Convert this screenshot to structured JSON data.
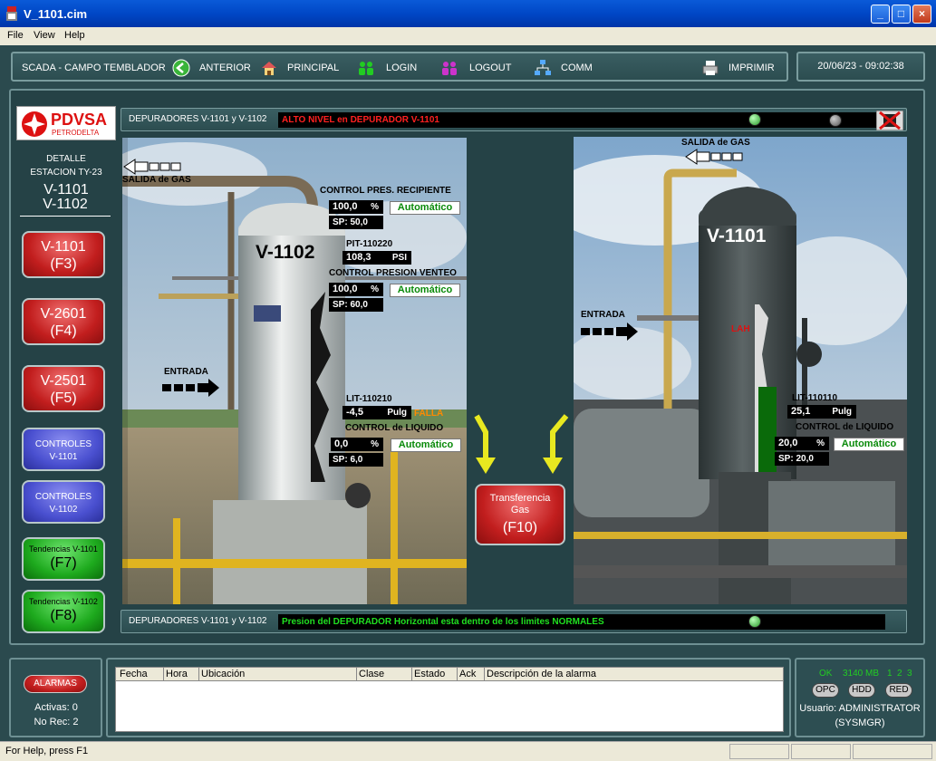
{
  "window": {
    "title": "V_1101.cim"
  },
  "menu": [
    "File",
    "View",
    "Help"
  ],
  "toolbar": {
    "app_label": "SCADA - CAMPO TEMBLADOR",
    "anterior": "ANTERIOR",
    "principal": "PRINCIPAL",
    "login": "LOGIN",
    "logout": "LOGOUT",
    "comm": "COMM",
    "imprimir": "IMPRIMIR",
    "datetime": "20/06/23 - 09:02:38"
  },
  "sidebar": {
    "logo_text": "PDVSA",
    "logo_sub": "PETRODELTA",
    "detail_line1": "DETALLE",
    "detail_line2": "ESTACION TY-23",
    "vessel1": "V-1101",
    "vessel2": "V-1102",
    "buttons": [
      {
        "line1": "V-1101",
        "line2": "(F3)"
      },
      {
        "line1": "V-2601",
        "line2": "(F4)"
      },
      {
        "line1": "V-2501",
        "line2": "(F5)"
      },
      {
        "line1": "CONTROLES",
        "line2": "V-1101"
      },
      {
        "line1": "CONTROLES",
        "line2": "V-1102"
      },
      {
        "line1": "Tendencias V-1101",
        "line2": "(F7)"
      },
      {
        "line1": "Tendencias V-1102",
        "line2": "(F8)"
      }
    ]
  },
  "top_message": {
    "label": "DEPURADORES V-1101 y V-1102",
    "text": "ALTO NIVEL en DEPURADOR V-1101",
    "color": "#ff2020"
  },
  "bottom_message": {
    "label": "DEPURADORES V-1101 y V-1102",
    "text": "Presion del DEPURADOR Horizontal esta dentro de los limites NORMALES",
    "color": "#20e020"
  },
  "v1102": {
    "name": "V-1102",
    "salida_gas": "SALIDA de GAS",
    "entrada": "ENTRADA",
    "ctrl_pres_title": "CONTROL PRES. RECIPIENTE",
    "ctrl_pres_value": "100,0",
    "ctrl_pres_unit": "%",
    "ctrl_pres_mode": "Automático",
    "ctrl_pres_sp": "SP: 50,0",
    "pit_tag": "PIT-110220",
    "pit_value": "108,3",
    "pit_unit": "PSI",
    "venteo_title": "CONTROL PRESION VENTEO",
    "venteo_value": "100,0",
    "venteo_unit": "%",
    "venteo_mode": "Automático",
    "venteo_sp": "SP: 60,0",
    "lit_tag": "LIT-110210",
    "lit_value": "-4,5",
    "lit_unit": "Pulg",
    "lit_status": "FALLA",
    "liq_title": "CONTROL de LIQUIDO",
    "liq_value": "0,0",
    "liq_unit": "%",
    "liq_mode": "Automático",
    "liq_sp": "SP: 6,0"
  },
  "v1101": {
    "name": "V-1101",
    "salida_gas": "SALIDA de GAS",
    "entrada": "ENTRADA",
    "lah": "LAH",
    "lit_tag": "LIT-110110",
    "lit_value": "25,1",
    "lit_unit": "Pulg",
    "liq_title": "CONTROL de LIQUIDO",
    "liq_value": "20,0",
    "liq_unit": "%",
    "liq_mode": "Automático",
    "liq_sp": "SP: 20,0"
  },
  "transfer": {
    "line1": "Transferencia",
    "line2": "Gas",
    "line3": "(F10)"
  },
  "alarms": {
    "button": "ALARMAS",
    "activas": "Activas: 0",
    "norec": "No Rec: 2",
    "columns": [
      "Fecha",
      "Hora",
      "Ubicación",
      "Clase",
      "Estado",
      "Ack",
      "Descripción de la alarma"
    ]
  },
  "system": {
    "ok": "OK",
    "memory": "3140 MB",
    "n1": "1",
    "n2": "2",
    "n3": "3",
    "opc": "OPC",
    "hdd": "HDD",
    "red": "RED",
    "user": "Usuario: ADMINISTRATOR",
    "group": "(SYSMGR)"
  },
  "statusbar": {
    "help": "For Help, press F1"
  }
}
